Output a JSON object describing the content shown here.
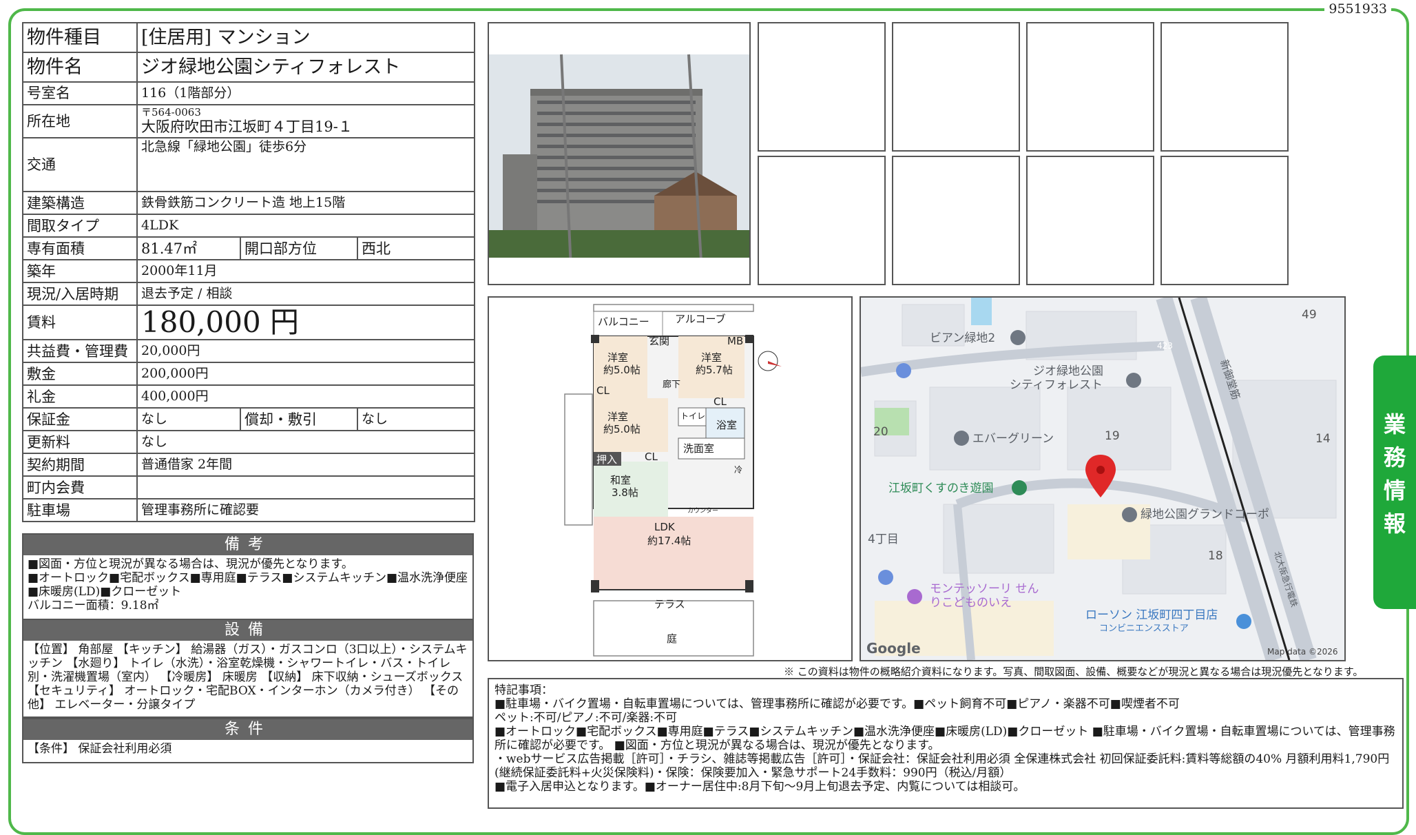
{
  "doc_id": "9551933",
  "side_tab": [
    "業",
    "務",
    "情",
    "報"
  ],
  "spec": {
    "type_label": "物件種目",
    "type_value": "[住居用]  マンション",
    "name_label": "物件名",
    "name_value": "ジオ緑地公園シティフォレスト",
    "room_label": "号室名",
    "room_value": "116（1階部分）",
    "address_label": "所在地",
    "postal": "〒564-0063",
    "address": "大阪府吹田市江坂町４丁目19-１",
    "access_label": "交通",
    "access_value": "北急線「緑地公園」徒歩6分",
    "structure_label": "建築構造",
    "structure_value": "鉄骨鉄筋コンクリート造  地上15階",
    "layout_label": "間取タイプ",
    "layout_value": "4LDK",
    "area_label": "専有面積",
    "area_value": "81.47㎡",
    "direction_label": "開口部方位",
    "direction_value": "西北",
    "built_label": "築年",
    "built_value": "2000年11月",
    "status_label": "現況/入居時期",
    "status_value": "退去予定  /  相談",
    "rent_label": "賃料",
    "rent_value": "180,000 円",
    "fee_label": "共益費・管理費",
    "fee_value": "20,000円",
    "deposit_label": "敷金",
    "deposit_value": "200,000円",
    "key_money_label": "礼金",
    "key_money_value": "400,000円",
    "guarantee_label": "保証金",
    "guarantee_value": "なし",
    "amort_label": "償却・敷引",
    "amort_value": "なし",
    "renewal_label": "更新料",
    "renewal_value": "なし",
    "contract_label": "契約期間",
    "contract_value": "普通借家  2年間",
    "town_fee_label": "町内会費",
    "town_fee_value": "",
    "parking_label": "駐車場",
    "parking_value": "管理事務所に確認要"
  },
  "biko": {
    "title": "備考",
    "lines": [
      "■図面・方位と現況が異なる場合は、現況が優先となります。",
      "■オートロック■宅配ボックス■専用庭■テラス■システムキッチン■温水洗浄便座■床暖房(LD)■クローゼット",
      "バルコニー面積：9.18㎡"
    ]
  },
  "setsubi": {
    "title": "設備",
    "text": "【位置】 角部屋 【キッチン】 給湯器（ガス）・ガスコンロ（3口以上）・システムキッチン 【水廻り】 トイレ（水洗）・浴室乾燥機・シャワートイレ・バス・トイレ別・洗濯機置場（室内） 【冷暖房】 床暖房 【収納】 床下収納・シューズボックス 【セキュリティ】 オートロック・宅配BOX・インターホン（カメラ付き） 【その他】 エレベーター・分譲タイプ"
  },
  "joken": {
    "title": "条件",
    "text": "【条件】 保証会社利用必須"
  },
  "floorplan": {
    "balcony": "バルコニー",
    "alcove": "アルコーブ",
    "genkan": "玄関",
    "mb": "MB",
    "yoshitsu": "洋室",
    "r1": "約5.0帖",
    "r2": "約5.7帖",
    "r3": "約5.0帖",
    "cl": "CL",
    "toilet": "トイレ",
    "roka": "廊下",
    "bath": "浴室",
    "senmen": "洗面室",
    "oshiire": "押入",
    "washitsu": "和室",
    "r4": "3.8帖",
    "ldk": "LDK",
    "r5": "約17.4帖",
    "terrace": "テラス",
    "niwa": "庭",
    "rei": "冷",
    "counter": "カウンター"
  },
  "map": {
    "labels": [
      "ビアン緑地2",
      "ジオ緑地公園",
      "シティフォレスト",
      "エバーグリーン",
      "江坂町くすのき遊園",
      "緑地公園グランドコーポ",
      "4丁目",
      "モンテッソーリ せん",
      "りこどものいえ",
      "ローソン 江坂町四丁目店",
      "コンビニエンスストア",
      "新御堂筋",
      "北大阪急行電鉄"
    ],
    "numbers": [
      "49",
      "20",
      "19",
      "14",
      "18",
      "423"
    ],
    "attribution": "Map data ©2026",
    "logo": "Google"
  },
  "notice": "※ この資料は物件の概略紹介資料になります。写真、間取図面、設備、概要などが現況と異なる場合は現況優先となります。",
  "remarks": {
    "title": "特記事項：",
    "lines": [
      "■駐車場・バイク置場・自転車置場については、管理事務所に確認が必要です。■ペット飼育不可■ピアノ・楽器不可■喫煙者不可",
      "ペット:不可/ピアノ:不可/楽器:不可",
      "■オートロック■宅配ボックス■専用庭■テラス■システムキッチン■温水洗浄便座■床暖房(LD)■クローゼット ■駐車場・バイク置場・自転車置場については、管理事務所に確認が必要です。 ■図面・方位と現況が異なる場合は、現況が優先となります。",
      "・webサービス広告掲載［許可］・チラシ、雑誌等掲載広告［許可］・保証会社：保証会社利用必須 全保連株式会社 初回保証委託料:賃料等総額の40% 月額利用料1,790円(継続保証委託料+火災保険料)・保険：保険要加入・緊急サポート24手数料：990円（税込/月額）",
      "■電子入居申込となります。■オーナー居住中:8月下旬〜9月上旬退去予定、内覧については相談可。"
    ]
  },
  "colors": {
    "frame": "#4fb84a",
    "side_tab": "#1fa83a",
    "header_band": "#666666",
    "map_pin": "#e02828"
  }
}
